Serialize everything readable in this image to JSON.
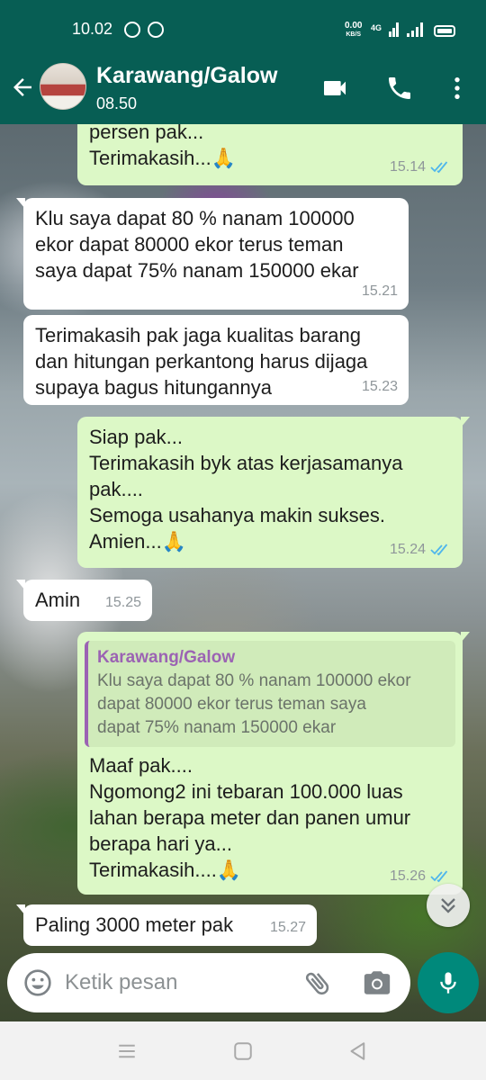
{
  "status_bar": {
    "time": "10.02",
    "net_speed_value": "0.00",
    "net_speed_unit": "KB/S",
    "network_type": "4G"
  },
  "header": {
    "title": "Karawang/Galow",
    "subtitle": "08.50"
  },
  "messages": [
    {
      "direction": "out",
      "text": "persen pak...\nTerimakasih...🙏",
      "time": "15.14",
      "status": "read"
    },
    {
      "direction": "in",
      "text": "Klu saya dapat 80 % nanam 100000\nekor dapat 80000 ekor terus teman\nsaya dapat 75% nanam 150000 ekar",
      "time": "15.21"
    },
    {
      "direction": "in",
      "text": "Terimakasih pak jaga kualitas barang\ndan hitungan perkantong harus dijaga\nsupaya bagus hitungannya",
      "time": "15.23"
    },
    {
      "direction": "out",
      "text": "Siap pak...\nTerimakasih byk atas kerjasamanya\npak....\nSemoga usahanya makin sukses.\nAmien...🙏",
      "time": "15.24",
      "status": "read"
    },
    {
      "direction": "in",
      "text": "Amin",
      "time": "15.25"
    },
    {
      "direction": "out",
      "quote": {
        "author": "Karawang/Galow",
        "text": "Klu saya dapat 80 % nanam 100000 ekor\ndapat 80000 ekor terus teman saya\ndapat 75% nanam 150000 ekar"
      },
      "text": "Maaf pak....\nNgomong2 ini tebaran 100.000 luas\nlahan berapa meter dan panen umur\nberapa hari ya...\nTerimakasih....🙏",
      "time": "15.26",
      "status": "read"
    },
    {
      "direction": "in",
      "text": "Paling 3000 meter pak",
      "time": "15.27"
    }
  ],
  "input": {
    "placeholder": "Ketik pesan",
    "value": ""
  },
  "icons": {
    "back": "arrow-left-icon",
    "video_call": "video-camera-icon",
    "voice_call": "phone-icon",
    "menu": "more-vertical-icon",
    "emoji": "smiley-icon",
    "attach": "paperclip-icon",
    "camera": "camera-icon",
    "mic": "microphone-icon",
    "scroll_down": "double-chevron-down-icon"
  },
  "colors": {
    "header": "#075e54",
    "outgoing_bubble": "#dcf8c6",
    "incoming_bubble": "#ffffff",
    "read_ticks": "#4fb6ec",
    "mic_button": "#00897b",
    "quote_author": "#9b63b3"
  }
}
